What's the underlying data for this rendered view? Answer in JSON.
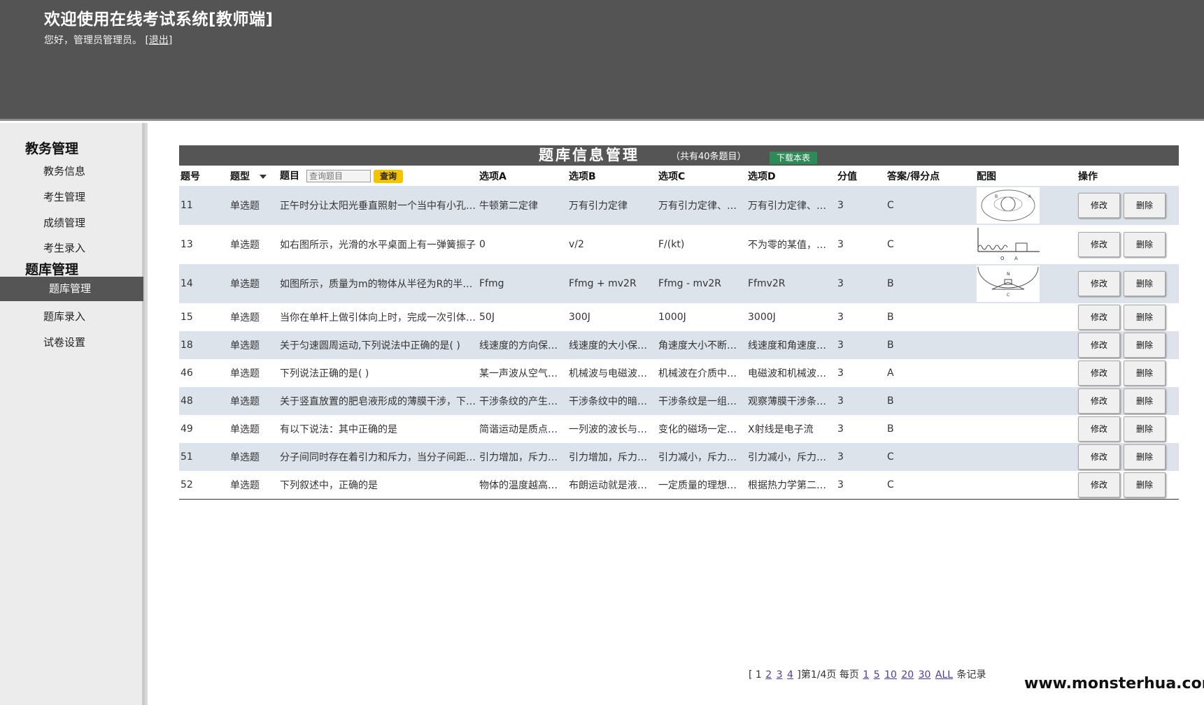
{
  "header": {
    "title": "欢迎使用在线考试系统[教师端]",
    "greeting": "您好，管理员管理员。",
    "logout_label": "[退出]"
  },
  "sidebar": {
    "sections": [
      {
        "title": "教务管理",
        "items": [
          "教务信息",
          "考生管理",
          "成绩管理",
          "考生录入"
        ]
      },
      {
        "title": "题库管理",
        "items": [
          "题库管理",
          "题库录入",
          "试卷设置"
        ]
      }
    ],
    "active_item": "题库管理"
  },
  "main": {
    "title": "题库信息管理",
    "count": "（共有40条题目）",
    "download_label": "下载本表",
    "columns": [
      "题号",
      "题型",
      "题目",
      "选项A",
      "选项B",
      "选项C",
      "选项D",
      "分值",
      "答案/得分点",
      "配图",
      "操作"
    ],
    "search_placeholder": "查询题目",
    "search_button": "查询",
    "edit_label": "修改",
    "delete_label": "删除",
    "rows": [
      {
        "id": "11",
        "type": "单选题",
        "question": "正午时分让太阳光垂直照射一个当中有小孔的黑纸板",
        "a": "牛顿第二定律",
        "b": "万有引力定律",
        "c": "万有引力定律、牛顿第二定律",
        "d": "万有引力定律、牛顿第三定律",
        "score": "3",
        "answer": "C",
        "image": "orbit"
      },
      {
        "id": "13",
        "type": "单选题",
        "question": "如右图所示，光滑的水平桌面上有一弹簧振子",
        "a": "0",
        "b": "v/2",
        "c": "F/(kt)",
        "d": "不为零的某值，但由题设条件无法求出",
        "score": "3",
        "answer": "C",
        "image": "spring"
      },
      {
        "id": "14",
        "type": "单选题",
        "question": "如图所示，质量为m的物体从半径为R的半球形碗边向碗底滑动",
        "a": "Ffmg",
        "b": "Ffmg + mv2R",
        "c": "Ffmg - mv2R",
        "d": "Ffmv2R",
        "score": "3",
        "answer": "B",
        "image": "bowl"
      },
      {
        "id": "15",
        "type": "单选题",
        "question": "当你在单杆上做引体向上时，完成一次引体向上动作",
        "a": "50J",
        "b": "300J",
        "c": "1000J",
        "d": "3000J",
        "score": "3",
        "answer": "B",
        "image": ""
      },
      {
        "id": "18",
        "type": "单选题",
        "question": "关于匀速圆周运动,下列说法中正确的是( )",
        "a": "线速度的方向保持不变",
        "b": "线速度的大小保持不变",
        "c": "角速度大小不断变化",
        "d": "线速度和角速度都保持不变",
        "score": "3",
        "answer": "B",
        "image": ""
      },
      {
        "id": "46",
        "type": "单选题",
        "question": "下列说法正确的是( )",
        "a": "某一声波从空气射入水中",
        "b": "机械波与电磁波都可以在真空中传播",
        "c": "机械波在介质中传播",
        "d": "电磁波和机械波都能发生干涉",
        "score": "3",
        "answer": "A",
        "image": ""
      },
      {
        "id": "48",
        "type": "单选题",
        "question": "关于竖直放置的肥皂液形成的薄膜干涉，下列说法正确的是",
        "a": "干涉条纹的产生是由于光在薄膜前后两表面反射",
        "b": "干涉条纹中的暗纹是由于上述两列反射波",
        "c": "干涉条纹是一组水平的直线",
        "d": "观察薄膜干涉条纹时",
        "score": "3",
        "answer": "B",
        "image": ""
      },
      {
        "id": "49",
        "type": "单选题",
        "question": "有以下说法：其中正确的是",
        "a": "简谐运动是质点所受的合外力",
        "b": "一列波的波长与障碍物的尺寸",
        "c": "变化的磁场一定会产生变化的电场",
        "d": "X射线是电子流",
        "score": "3",
        "answer": "B",
        "image": ""
      },
      {
        "id": "51",
        "type": "单选题",
        "question": "分子间同时存在着引力和斥力，当分子间距增加时",
        "a": "引力增加，斥力减小",
        "b": "引力增加，斥力增加",
        "c": "引力减小，斥力增加",
        "d": "引力减小，斥力减小",
        "score": "3",
        "answer": "C",
        "image": ""
      },
      {
        "id": "52",
        "type": "单选题",
        "question": "下列叙述中，正确的是",
        "a": "物体的温度越高，分子热运动越剧烈",
        "b": "布朗运动就是液体分子的热运动",
        "c": "一定质量的理想气体从外界吸收热量",
        "d": "根据热力学第二定律可知",
        "score": "3",
        "answer": "C",
        "image": ""
      }
    ]
  },
  "pager": {
    "open": "[ 1",
    "pages": [
      "2",
      "3",
      "4"
    ],
    "status": "]第1/4页 每页",
    "sizes": [
      "1",
      "5",
      "10",
      "20",
      "30",
      "ALL"
    ],
    "suffix": "条记录"
  },
  "watermark": "www.monsterhua.com"
}
